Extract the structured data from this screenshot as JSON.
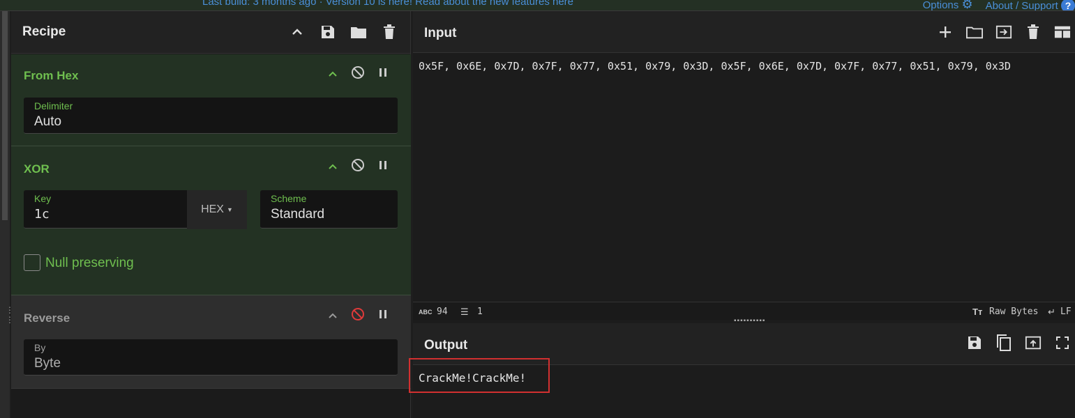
{
  "topbar": {
    "message": "Last build: 3 months ago · Version 10 is here! Read about the new features here",
    "options_label": "Options",
    "about_label": "About / Support",
    "help_glyph": "?"
  },
  "recipe": {
    "title": "Recipe",
    "operations": [
      {
        "name": "From Hex",
        "fields": [
          {
            "label": "Delimiter",
            "value": "Auto"
          }
        ]
      },
      {
        "name": "XOR",
        "fields": [
          {
            "label": "Key",
            "value": "1c",
            "encoding": "HEX"
          },
          {
            "label": "Scheme",
            "value": "Standard"
          }
        ],
        "checkbox": {
          "label": "Null preserving",
          "checked": false
        }
      },
      {
        "name": "Reverse",
        "disabled": true,
        "fields": [
          {
            "label": "By",
            "value": "Byte"
          }
        ]
      }
    ]
  },
  "input": {
    "title": "Input",
    "text": "0x5F, 0x6E, 0x7D, 0x7F, 0x77, 0x51, 0x79, 0x3D, 0x5F, 0x6E, 0x7D, 0x7F, 0x77, 0x51, 0x79, 0x3D",
    "status": {
      "abc_badge": "ABC",
      "length": "94",
      "lines": "1",
      "raw_bytes": "Raw Bytes",
      "eol": "LF"
    }
  },
  "output": {
    "title": "Output",
    "text": "CrackMe!CrackMe!"
  },
  "colors": {
    "accent_green": "#6fbf4f",
    "link_blue": "#4a8fd8",
    "disabled_red": "#e03a3a",
    "highlight_red": "#d23030"
  }
}
